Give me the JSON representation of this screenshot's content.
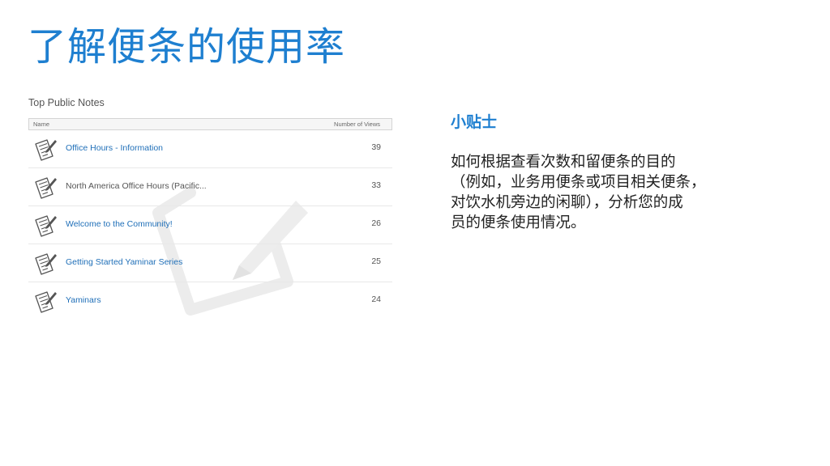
{
  "slide": {
    "title": "了解便条的使用率"
  },
  "notes_panel": {
    "heading": "Top Public Notes",
    "columns": {
      "name": "Name",
      "views": "Number of Views"
    },
    "rows": [
      {
        "title": "Office Hours - Information",
        "views": "39",
        "style": "link",
        "icon": "note-pencil-icon"
      },
      {
        "title": "North America Office Hours (Pacific...",
        "views": "33",
        "style": "plain",
        "icon": "note-pencil-icon"
      },
      {
        "title": "Welcome to the Community!",
        "views": "26",
        "style": "link",
        "icon": "note-pencil-icon"
      },
      {
        "title": "Getting Started Yaminar Series",
        "views": "25",
        "style": "link",
        "icon": "note-pencil-icon"
      },
      {
        "title": "Yaminars",
        "views": "24",
        "style": "link",
        "icon": "note-pencil-icon"
      }
    ],
    "watermark_icon": "note-pencil-watermark-icon"
  },
  "tip": {
    "heading": "小贴士",
    "lines": [
      "如何根据查看次数和留便条的目的",
      "（例如，业务用便条或项目相关便条，",
      "对饮水机旁边的闲聊），分析您的成",
      "员的便条使用情况。"
    ]
  },
  "colors": {
    "accent": "#1e7fd0",
    "link": "#1f6fb8",
    "muted_text": "#555555",
    "body_text": "#222222"
  }
}
